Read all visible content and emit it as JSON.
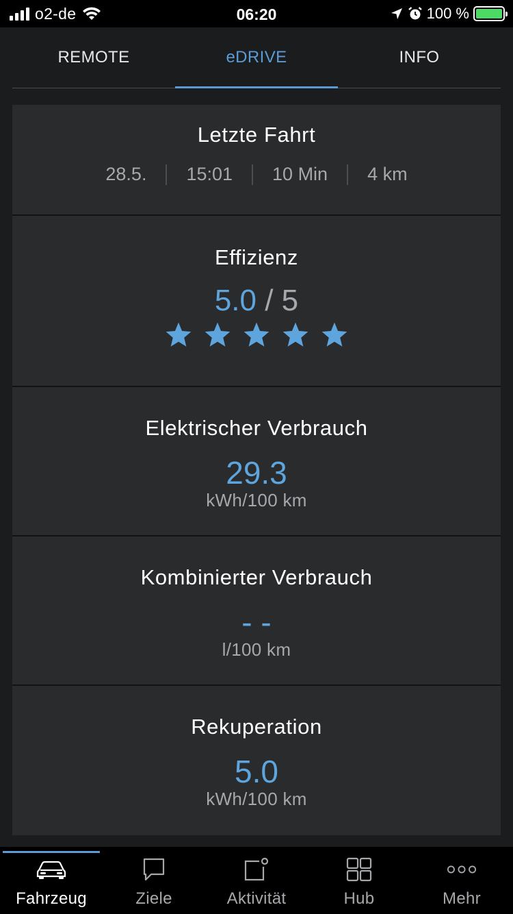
{
  "status_bar": {
    "carrier": "o2-de",
    "time": "06:20",
    "battery": "100 %"
  },
  "tabs": [
    {
      "label": "REMOTE",
      "active": false
    },
    {
      "label": "eDRIVE",
      "active": true
    },
    {
      "label": "INFO",
      "active": false
    }
  ],
  "last_trip": {
    "title": "Letzte Fahrt",
    "date": "28.5.",
    "time": "15:01",
    "duration": "10 Min",
    "distance": "4 km"
  },
  "efficiency": {
    "title": "Effizienz",
    "score": "5.0",
    "max": "/ 5",
    "stars_filled": 5,
    "stars_total": 5
  },
  "electric_consumption": {
    "title": "Elektrischer Verbrauch",
    "value": "29.3",
    "unit": "kWh/100 km"
  },
  "combined_consumption": {
    "title": "Kombinierter Verbrauch",
    "value": "- -",
    "unit": "l/100 km"
  },
  "recuperation": {
    "title": "Rekuperation",
    "value": "5.0",
    "unit": "kWh/100 km"
  },
  "bottom_nav": [
    {
      "label": "Fahrzeug",
      "icon": "car-icon",
      "active": true
    },
    {
      "label": "Ziele",
      "icon": "speech-bubble-icon",
      "active": false
    },
    {
      "label": "Aktivität",
      "icon": "activity-icon",
      "active": false
    },
    {
      "label": "Hub",
      "icon": "grid-icon",
      "active": false
    },
    {
      "label": "Mehr",
      "icon": "more-dots-icon",
      "active": false
    }
  ],
  "colors": {
    "accent": "#5b9bd5",
    "value": "#5ea4dd",
    "card_bg": "#2a2b2d",
    "page_bg": "#1b1c1e"
  }
}
